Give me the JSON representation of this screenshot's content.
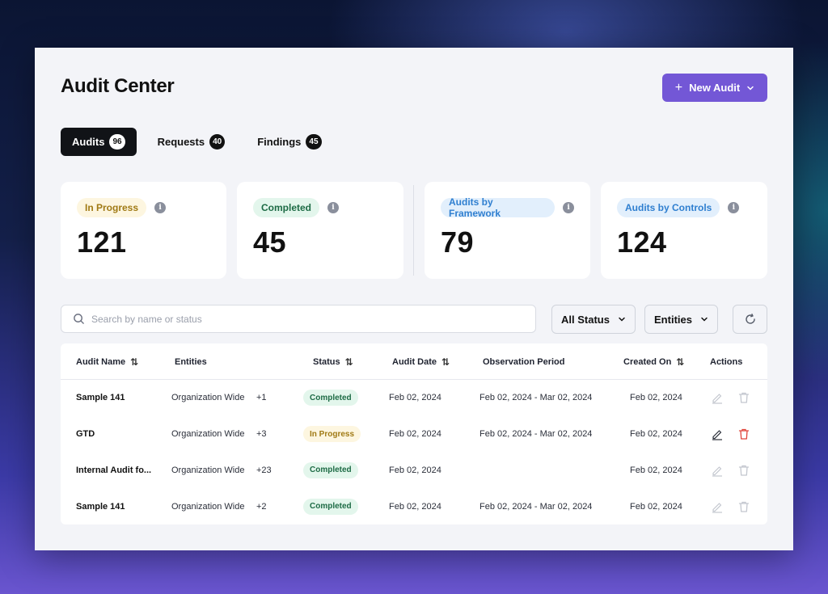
{
  "header": {
    "title": "Audit Center",
    "new_audit_label": "New Audit"
  },
  "tabs": [
    {
      "label": "Audits",
      "count": "96",
      "active": true
    },
    {
      "label": "Requests",
      "count": "40",
      "active": false
    },
    {
      "label": "Findings",
      "count": "45",
      "active": false
    }
  ],
  "stats": [
    {
      "label": "In Progress",
      "value": "121",
      "pill_bg": "#fdf6e0",
      "pill_fg": "#a07a14"
    },
    {
      "label": "Completed",
      "value": "45",
      "pill_bg": "#e3f6ec",
      "pill_fg": "#1d6b45"
    },
    {
      "label": "Audits by Framework",
      "value": "79",
      "pill_bg": "#e2effc",
      "pill_fg": "#2f7fd0"
    },
    {
      "label": "Audits by Controls",
      "value": "124",
      "pill_bg": "#e2effc",
      "pill_fg": "#2f7fd0"
    }
  ],
  "search": {
    "placeholder": "Search by name or status",
    "value": ""
  },
  "filters": {
    "status_label": "All Status",
    "entities_label": "Entities"
  },
  "table": {
    "columns": {
      "name": "Audit Name",
      "entities": "Entities",
      "status": "Status",
      "date": "Audit Date",
      "period": "Observation Period",
      "created": "Created On",
      "actions": "Actions"
    },
    "rows": [
      {
        "name": "Sample 141",
        "entity": "Organization Wide",
        "extra": "+1",
        "status": "Completed",
        "date": "Feb 02, 2024",
        "period": "Feb 02, 2024 - Mar 02, 2024",
        "created": "Feb 02, 2024",
        "actions_active": false
      },
      {
        "name": "GTD",
        "entity": "Organization Wide",
        "extra": "+3",
        "status": "In Progress",
        "date": "Feb 02, 2024",
        "period": "Feb 02, 2024 - Mar 02, 2024",
        "created": "Feb 02, 2024",
        "actions_active": true
      },
      {
        "name": "Internal Audit fo...",
        "entity": "Organization Wide",
        "extra": "+23",
        "status": "Completed",
        "date": "Feb 02, 2024",
        "period": "",
        "created": "Feb 02, 2024",
        "actions_active": false
      },
      {
        "name": "Sample 141",
        "entity": "Organization Wide",
        "extra": "+2",
        "status": "Completed",
        "date": "Feb 02, 2024",
        "period": "Feb 02, 2024 - Mar 02, 2024",
        "created": "Feb 02, 2024",
        "actions_active": false
      }
    ]
  },
  "colors": {
    "accent": "#7357d6",
    "completed_bg": "#e3f6ec",
    "completed_fg": "#1d6b45",
    "progress_bg": "#fdf6e0",
    "progress_fg": "#a07a14",
    "delete_active": "#e0443a"
  },
  "icons": {
    "new_audit": "plus-icon",
    "new_audit_caret": "chevron-down-icon",
    "stat_info": "info-icon",
    "search": "search-icon",
    "refresh": "refresh-icon",
    "sort": "sort-icon",
    "edit": "pencil-icon",
    "delete": "trash-icon"
  }
}
